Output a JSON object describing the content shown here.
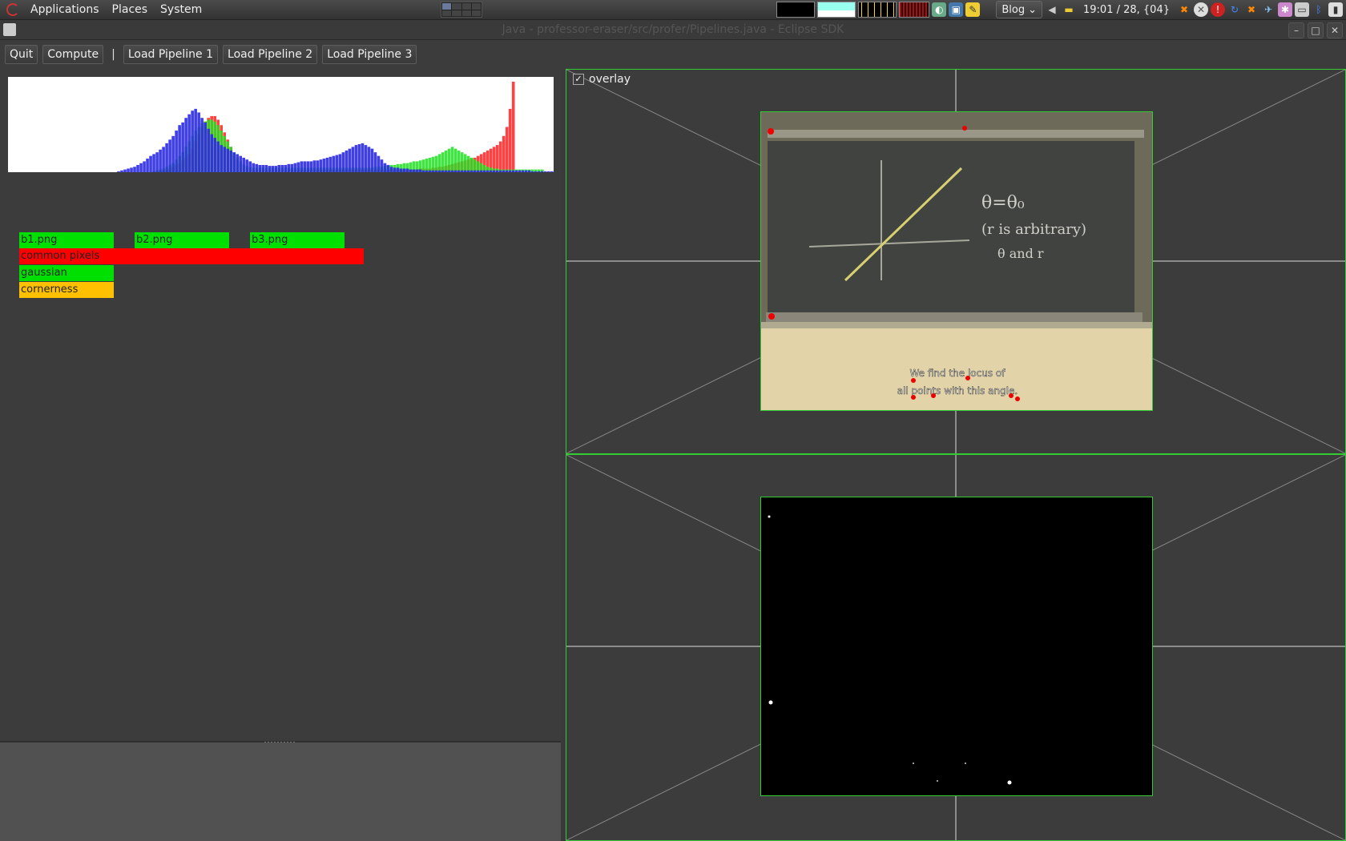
{
  "panel": {
    "menus": [
      "Applications",
      "Places",
      "System"
    ],
    "blog_dropdown": "Blog",
    "clock": "19:01 / 28, {04}"
  },
  "window": {
    "title": "Java - professor-eraser/src/profer/Pipelines.java - Eclipse SDK"
  },
  "toolbar": {
    "quit": "Quit",
    "compute": "Compute",
    "separator": "|",
    "pipeline1": "Load Pipeline 1",
    "pipeline2": "Load Pipeline 2",
    "pipeline3": "Load Pipeline 3"
  },
  "pipeline_bars": [
    {
      "label": "b1.png",
      "color": "#00e000"
    },
    {
      "label": "b2.png",
      "color": "#00e000"
    },
    {
      "label": "b3.png",
      "color": "#00e000"
    },
    {
      "label": "common pixels",
      "color": "#ff0000"
    },
    {
      "label": "gaussian",
      "color": "#00e000"
    },
    {
      "label": "cornerness",
      "color": "#ffc000"
    }
  ],
  "histogram": {
    "blue": [
      0,
      0,
      0,
      0,
      0,
      0,
      0,
      0,
      0,
      0,
      0,
      0,
      0,
      0,
      0,
      0,
      0,
      0,
      0,
      0,
      0,
      0,
      0,
      0,
      0,
      0,
      0,
      0,
      0,
      0,
      0,
      0,
      0,
      0,
      1,
      2,
      3,
      4,
      5,
      6,
      8,
      10,
      12,
      15,
      18,
      20,
      22,
      25,
      28,
      32,
      36,
      40,
      46,
      52,
      55,
      60,
      64,
      68,
      70,
      66,
      60,
      55,
      48,
      42,
      38,
      34,
      30,
      28,
      26,
      24,
      22,
      20,
      18,
      16,
      14,
      12,
      10,
      9,
      8,
      8,
      8,
      7,
      7,
      7,
      8,
      8,
      8,
      9,
      9,
      10,
      11,
      12,
      12,
      12,
      12,
      13,
      13,
      14,
      15,
      16,
      17,
      18,
      19,
      20,
      22,
      24,
      26,
      28,
      30,
      31,
      32,
      30,
      28,
      26,
      22,
      18,
      14,
      10,
      8,
      6,
      5,
      5,
      4,
      4,
      4,
      3,
      3,
      3,
      3,
      2,
      2,
      2,
      2,
      2,
      2,
      2,
      2,
      2,
      2,
      2,
      2,
      2,
      2,
      2,
      2,
      2,
      2,
      2,
      2,
      2,
      2,
      2,
      2,
      2,
      2,
      2,
      2,
      2,
      2,
      2,
      2,
      2,
      2,
      1,
      1,
      1,
      1,
      1,
      1,
      1
    ],
    "green": [
      0,
      0,
      0,
      0,
      0,
      0,
      0,
      0,
      0,
      0,
      0,
      0,
      0,
      0,
      0,
      0,
      0,
      0,
      0,
      0,
      0,
      0,
      0,
      0,
      0,
      0,
      0,
      0,
      0,
      0,
      0,
      0,
      0,
      0,
      0,
      0,
      0,
      0,
      0,
      0,
      0,
      0,
      0,
      0,
      0,
      1,
      2,
      3,
      4,
      6,
      8,
      10,
      14,
      18,
      22,
      28,
      34,
      40,
      46,
      50,
      54,
      56,
      58,
      58,
      56,
      52,
      46,
      40,
      34,
      28,
      22,
      16,
      12,
      9,
      7,
      6,
      5,
      5,
      5,
      5,
      5,
      5,
      5,
      5,
      5,
      5,
      5,
      5,
      5,
      5,
      5,
      5,
      5,
      5,
      5,
      5,
      5,
      5,
      5,
      5,
      5,
      5,
      5,
      5,
      5,
      5,
      5,
      5,
      5,
      5,
      5,
      5,
      5,
      5,
      6,
      6,
      6,
      7,
      7,
      8,
      8,
      9,
      9,
      10,
      10,
      11,
      12,
      12,
      13,
      14,
      15,
      16,
      17,
      18,
      20,
      22,
      24,
      26,
      28,
      26,
      24,
      22,
      20,
      18,
      16,
      14,
      12,
      10,
      8,
      6,
      5,
      4,
      4,
      3,
      3,
      3,
      3,
      3,
      3,
      3,
      3,
      3,
      3,
      3,
      3,
      3,
      3
    ],
    "red": [
      0,
      0,
      0,
      0,
      0,
      0,
      0,
      0,
      0,
      0,
      0,
      0,
      0,
      0,
      0,
      0,
      0,
      0,
      0,
      0,
      0,
      0,
      0,
      0,
      0,
      0,
      0,
      0,
      0,
      0,
      0,
      0,
      0,
      0,
      0,
      0,
      0,
      0,
      0,
      0,
      0,
      0,
      0,
      0,
      0,
      0,
      0,
      1,
      2,
      3,
      4,
      6,
      8,
      10,
      13,
      16,
      20,
      26,
      34,
      42,
      50,
      56,
      60,
      62,
      62,
      58,
      52,
      44,
      36,
      28,
      20,
      14,
      10,
      7,
      5,
      4,
      3,
      3,
      3,
      3,
      3,
      3,
      3,
      3,
      3,
      3,
      3,
      3,
      3,
      3,
      3,
      3,
      3,
      3,
      3,
      3,
      3,
      3,
      3,
      3,
      3,
      3,
      3,
      3,
      3,
      3,
      3,
      3,
      3,
      3,
      3,
      3,
      3,
      3,
      3,
      3,
      3,
      3,
      3,
      3,
      3,
      3,
      3,
      3,
      3,
      3,
      3,
      3,
      4,
      4,
      4,
      4,
      5,
      5,
      6,
      6,
      7,
      8,
      9,
      10,
      11,
      12,
      13,
      14,
      15,
      16,
      18,
      20,
      22,
      24,
      26,
      28,
      30,
      34,
      40,
      50,
      70,
      100
    ]
  },
  "overlay": {
    "label": "overlay",
    "checked": true
  },
  "blackboard": {
    "line1": "θ=θ₀",
    "line2": "(r is arbitrary)",
    "line3": "θ and r",
    "caption1": "We find the locus of",
    "caption2": "all points with this angle."
  }
}
